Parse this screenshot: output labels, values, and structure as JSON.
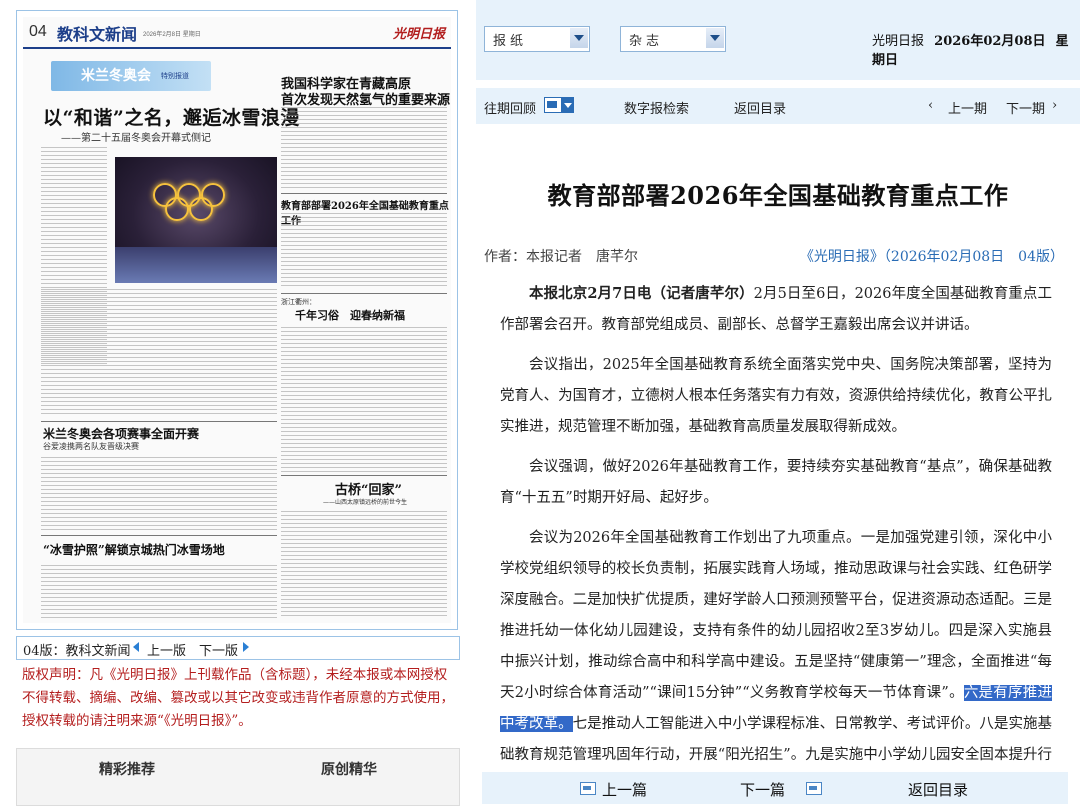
{
  "paper": {
    "page_num": "04",
    "section": "教科文新闻",
    "dateline": "2026年2月8日 星期日",
    "logo": "光明日报",
    "banner_text": "米兰冬奥会",
    "banner_sub": "特别报道",
    "headline_main": "以“和谐”之名，邂逅冰雪浪漫",
    "headline_sub": "——第二十五届冬奥会开幕式侧记",
    "story2_title_1": "我国科学家在青藏高原",
    "story2_title_2": "首次发现天然氢气的重要来源",
    "story3_title": "教育部部署2026年全国基础教育重点工作",
    "story4_kicker": "浙江衢州：",
    "story4_title": "千年习俗　迎春纳新福",
    "story5_title": "米兰冬奥会各项赛事全面开赛",
    "story5_sub": "谷爱凌携两名队友晋级决赛",
    "story6_title": "古桥“回家”",
    "story6_sub": "——山西太原镇远桥的前世今生",
    "story7_title": "“冰雪护照”解锁京城热门冰雪场地"
  },
  "page_nav": {
    "label": "04版：教科文新闻",
    "prev": "上一版",
    "next": "下一版"
  },
  "copyright": "版权声明：凡《光明日报》上刊载作品（含标题），未经本报或本网授权不得转载、摘编、改编、篡改或以其它改变或违背作者原意的方式使用，授权转载的请注明来源“《光明日报》”。",
  "tabs": [
    "精彩推荐",
    "原创精华"
  ],
  "topbar": {
    "select_paper": "报纸",
    "select_magazine": "杂志",
    "brand": "光明日报",
    "date": "2026年02月08日",
    "weekday": "星期日"
  },
  "navbar": {
    "archive": "往期回顾",
    "search": "数字报检索",
    "back": "返回目录",
    "prev_page": "上一期",
    "next_page": "下一期"
  },
  "article": {
    "title": "教育部部署2026年全国基础教育重点工作",
    "author": "作者：本报记者　唐芊尔",
    "source": "《光明日报》（2026年02月08日　04版）",
    "lead": "本报北京2月7日电（记者唐芊尔）",
    "p1_rest": "2月5日至6日，2026年度全国基础教育重点工作部署会召开。教育部党组成员、副部长、总督学王嘉毅出席会议并讲话。",
    "p2": "会议指出，2025年全国基础教育系统全面落实党中央、国务院决策部署，坚持为党育人、为国育才，立德树人根本任务落实有力有效，资源供给持续优化，教育公平扎实推进，规范管理不断加强，基础教育高质量发展取得新成效。",
    "p3": "会议强调，做好2026年基础教育工作，要持续夯实基础教育“基点”，确保基础教育“十五五”时期开好局、起好步。",
    "p4_a": "会议为2026年全国基础教育工作划出了九项重点。一是加强党建引领，深化中小学校党组织领导的校长负责制，拓展实践育人场域，推动思政课与社会实践、红色研学深度融合。二是加快扩优提质，建好学龄人口预测预警平台，促进资源动态适配。三是推进托幼一体化幼儿园建设，支持有条件的幼儿园招收2至3岁幼儿。四是深入实施县中振兴计划，推动综合高中和科学高中建设。五是坚持“健康第一”理念，全面推进“每天2小时综合体育活动”“课间15分钟”“义务教育学校每天一节体育课”。",
    "p4_selected": "六是有序推进中考改革。",
    "p4_b": "七是推动人工智能进入中小学课程标准、日常教学、考试评价。八是实施基础教育规范管理巩固年行动，开展“阳光招生”。九是实施中小学幼儿园安全固本提升行动计划，完善欺凌预防、发现、处置机制。"
  },
  "bottom_nav": {
    "prev": "上一篇",
    "next": "下一篇",
    "back": "返回目录"
  },
  "colors": {
    "accent_blue": "#2a6cb5",
    "copyright_red": "#b41e1e",
    "bar_bg": "#e7f2fb",
    "selection": "#3369c8"
  }
}
